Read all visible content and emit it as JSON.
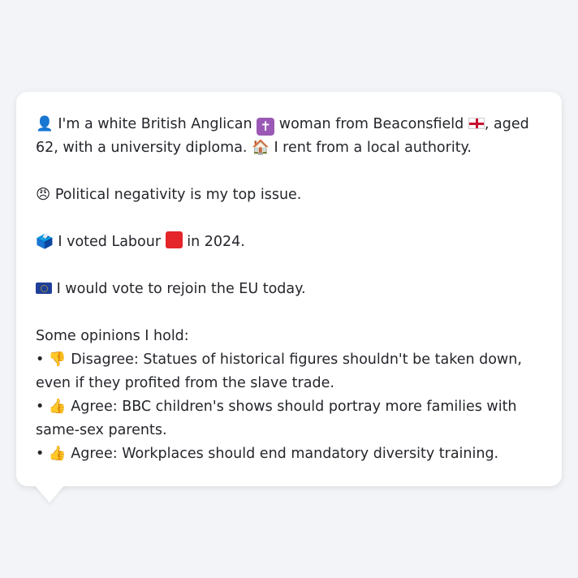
{
  "profile": {
    "intro_person_icon": "👤",
    "intro_text_1": "I'm a white British Anglican",
    "cross_icon": "✝",
    "intro_text_2": "woman from Beaconsfield",
    "intro_text_3": ", aged 62, with a university diploma.",
    "house_icon": "🏠",
    "intro_text_4": "I rent from a local authority."
  },
  "issue": {
    "icon": "😠",
    "text": "Political negativity is my top issue."
  },
  "vote": {
    "icon": "🗳️",
    "text_1": "I voted Labour",
    "text_2": "in 2024."
  },
  "eu": {
    "text": "I would vote to rejoin the EU today."
  },
  "opinions": {
    "heading": "Some opinions I hold:",
    "items": [
      {
        "bullet": "•",
        "icon": "👎",
        "stance": "Disagree:",
        "text": "Statues of historical figures shouldn't be taken down, even if they profited from the slave trade."
      },
      {
        "bullet": "•",
        "icon": "👍",
        "stance": "Agree:",
        "text": "BBC children's shows should portray more families with same-sex parents."
      },
      {
        "bullet": "•",
        "icon": "👍",
        "stance": "Agree:",
        "text": "Workplaces should end mandatory diversity training."
      }
    ]
  },
  "colors": {
    "background": "#f2f4f7",
    "card": "#ffffff",
    "text": "#24262b",
    "labour_red": "#e4252a",
    "eu_blue": "#1f3f99"
  }
}
